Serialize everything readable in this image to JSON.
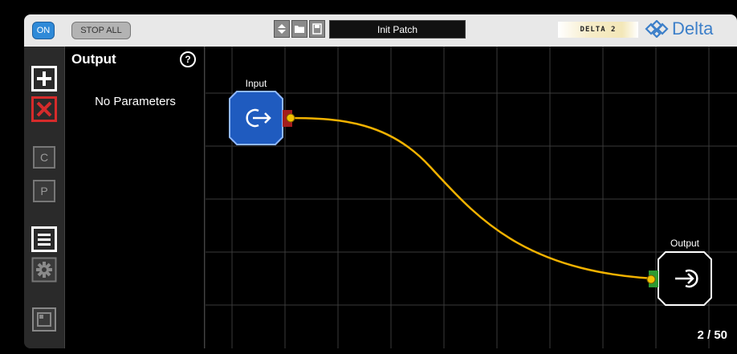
{
  "topbar": {
    "on_label": "ON",
    "stop_all_label": "STOP ALL",
    "preset_name": "Init Patch",
    "brand_tag": "DELTA 2",
    "brand_name": "Delta"
  },
  "panel": {
    "title": "Output",
    "empty_text": "No Parameters",
    "help_label": "?"
  },
  "toolbar": {
    "copy_label": "C",
    "paste_label": "P"
  },
  "nodes": {
    "input_label": "Input",
    "output_label": "Output"
  },
  "counter": "2 / 50",
  "colors": {
    "accent_blue": "#1f5bbf",
    "cable": "#f2b200",
    "delete_red": "#d62b2b",
    "port_red": "#a31d1d",
    "port_green": "#2d9a32"
  }
}
